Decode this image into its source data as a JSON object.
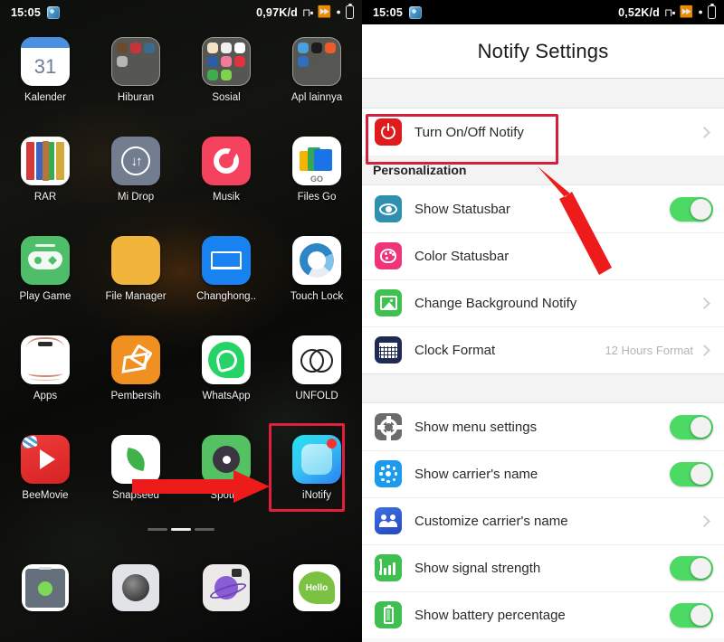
{
  "left_phone": {
    "statusbar": {
      "time": "15:05",
      "globe_icon": "globe-icon",
      "data_rate": "0,97K/d",
      "signal_icon": "signal-bars-icon",
      "telegram_icon": "telegram-icon",
      "battery_icon": "battery-icon"
    },
    "rows": [
      [
        {
          "label": "Kalender",
          "icon": "calendar-app-icon",
          "day": "31"
        },
        {
          "label": "Hiburan",
          "icon": "folder-icon"
        },
        {
          "label": "Sosial",
          "icon": "folder-icon"
        },
        {
          "label": "Apl lainnya",
          "icon": "folder-icon"
        }
      ],
      [
        {
          "label": "RAR",
          "icon": "rar-app-icon"
        },
        {
          "label": "Mi Drop",
          "icon": "midrop-app-icon"
        },
        {
          "label": "Musik",
          "icon": "music-app-icon"
        },
        {
          "label": "Files Go",
          "icon": "files-go-app-icon",
          "badge": "GO"
        }
      ],
      [
        {
          "label": "Play Game",
          "icon": "play-game-app-icon"
        },
        {
          "label": "File Manager",
          "icon": "file-manager-app-icon"
        },
        {
          "label": "Changhong..",
          "icon": "changhong-app-icon"
        },
        {
          "label": "Touch Lock",
          "icon": "touch-lock-app-icon"
        }
      ],
      [
        {
          "label": "Apps",
          "icon": "apps-app-icon"
        },
        {
          "label": "Pembersih",
          "icon": "cleaner-app-icon"
        },
        {
          "label": "WhatsApp",
          "icon": "whatsapp-app-icon"
        },
        {
          "label": "UNFOLD",
          "icon": "unfold-app-icon"
        }
      ],
      [
        {
          "label": "BeeMovie",
          "icon": "beemovie-app-icon"
        },
        {
          "label": "Snapseed",
          "icon": "snapseed-app-icon"
        },
        {
          "label": "Spotify",
          "icon": "spotify-app-icon"
        },
        {
          "label": "iNotify",
          "icon": "inotify-app-icon",
          "highlighted": true
        }
      ]
    ],
    "page_dots": {
      "total": 3,
      "active": 2
    },
    "dock": [
      {
        "icon": "phone-app-icon"
      },
      {
        "icon": "camera-app-icon"
      },
      {
        "icon": "browser-app-icon"
      },
      {
        "icon": "messages-app-icon"
      }
    ]
  },
  "right_phone": {
    "statusbar": {
      "time": "15:05",
      "globe_icon": "globe-icon",
      "data_rate": "0,52K/d",
      "signal_icon": "signal-bars-icon",
      "telegram_icon": "telegram-icon",
      "battery_icon": "battery-icon"
    },
    "title": "Notify Settings",
    "group_top": [
      {
        "label": "Turn On/Off Notify",
        "icon": "power-icon",
        "control": "chevron",
        "highlighted": true
      }
    ],
    "section_header": "Personalization",
    "group_personalization": [
      {
        "label": "Show Statusbar",
        "icon": "eye-icon",
        "control": "toggle",
        "toggle_on": true
      },
      {
        "label": "Color Statusbar",
        "icon": "palette-icon",
        "control": "none"
      },
      {
        "label": "Change Background Notify",
        "icon": "image-icon",
        "control": "chevron"
      },
      {
        "label": "Clock Format",
        "icon": "calendar-icon",
        "control": "chevron",
        "value": "12 Hours Format"
      }
    ],
    "group_bottom": [
      {
        "label": "Show menu settings",
        "icon": "gear-icon",
        "control": "toggle",
        "toggle_on": true
      },
      {
        "label": "Show carrier's name",
        "icon": "carrier-icon",
        "control": "toggle",
        "toggle_on": true
      },
      {
        "label": "Customize carrier's name",
        "icon": "people-icon",
        "control": "chevron"
      },
      {
        "label": "Show signal strength",
        "icon": "signal-strength-icon",
        "control": "toggle",
        "toggle_on": true
      },
      {
        "label": "Show battery percentage",
        "icon": "battery-level-icon",
        "control": "toggle",
        "toggle_on": true
      }
    ]
  },
  "annotations": {
    "highlight_color": "#d61f3e",
    "arrow_color": "#ee1b1b",
    "left_arrow_name": "red-arrow-pointing-to-inotify",
    "right_arrow_name": "red-arrow-pointing-to-turn-on-off-notify"
  }
}
